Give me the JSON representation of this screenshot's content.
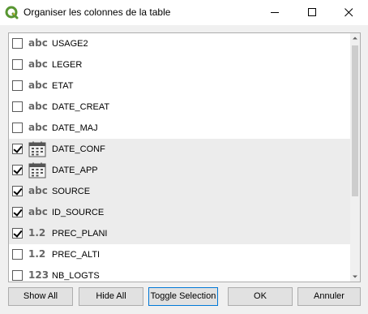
{
  "window": {
    "title": "Organiser les colonnes de la table"
  },
  "fields": [
    {
      "name": "USAGE2",
      "type": "abc",
      "checked": false,
      "selected": false
    },
    {
      "name": "LEGER",
      "type": "abc",
      "checked": false,
      "selected": false
    },
    {
      "name": "ETAT",
      "type": "abc",
      "checked": false,
      "selected": false
    },
    {
      "name": "DATE_CREAT",
      "type": "abc",
      "checked": false,
      "selected": false
    },
    {
      "name": "DATE_MAJ",
      "type": "abc",
      "checked": false,
      "selected": false
    },
    {
      "name": "DATE_CONF",
      "type": "date",
      "checked": true,
      "selected": true
    },
    {
      "name": "DATE_APP",
      "type": "date",
      "checked": true,
      "selected": true
    },
    {
      "name": "SOURCE",
      "type": "abc",
      "checked": true,
      "selected": true
    },
    {
      "name": "ID_SOURCE",
      "type": "abc",
      "checked": true,
      "selected": true
    },
    {
      "name": "PREC_PLANI",
      "type": "1.2",
      "checked": true,
      "selected": true
    },
    {
      "name": "PREC_ALTI",
      "type": "1.2",
      "checked": false,
      "selected": false
    },
    {
      "name": "NB_LOGTS",
      "type": "123",
      "checked": false,
      "selected": false
    }
  ],
  "buttons": {
    "show_all": "Show All",
    "hide_all": "Hide All",
    "toggle_selection": "Toggle Selection",
    "ok": "OK",
    "cancel": "Annuler"
  },
  "colors": {
    "qgis_green": "#589632",
    "selected_row": "#ececec",
    "type_text": "#666666"
  }
}
